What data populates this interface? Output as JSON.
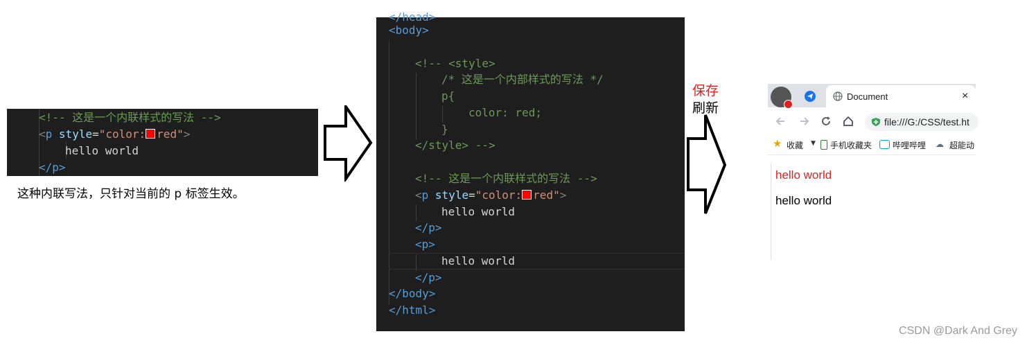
{
  "left_code": {
    "lines": [
      {
        "comment": "<!-- 这是一个内联样式的写法 -->"
      },
      {
        "p_open": "<p",
        "attr": "style",
        "eq": "=",
        "q1": "\"",
        "val1": "color:",
        "val2": "red",
        "q2": "\"",
        "close": ">"
      },
      {
        "text": "hello world"
      },
      {
        "p_close": "</p>"
      }
    ]
  },
  "left_caption": "这种内联写法，只针对当前的 p 标签生效。",
  "middle_code": {
    "head_close": "</head>",
    "body_open": "<body>",
    "style_comment_open": "<!-- <style>",
    "css_comment": "/* 这是一个内部样式的写法 */",
    "selector": "p{",
    "declaration": "color: red;",
    "brace_close": "}",
    "style_comment_close": "</style> -->",
    "inline_comment": "<!-- 这是一个内联样式的写法 -->",
    "p_open": "<p",
    "attr": "style",
    "eq": "=",
    "q1": "\"",
    "val1": "color:",
    "val2": "red",
    "q2": "\"",
    "gt": ">",
    "hello1": "hello world",
    "p_close1": "</p>",
    "p_open2": "<p>",
    "hello2": "hello world",
    "p_close2": "</p>",
    "body_close": "</body>",
    "html_close": "</html>"
  },
  "save_label": "保存",
  "refresh_label": "刷新",
  "browser": {
    "tab_title": "Document",
    "close_glyph": "×",
    "address": "file:///G:/CSS/test.ht",
    "bookmarks": [
      {
        "label": "收藏",
        "icon": "star-icon"
      },
      {
        "label": "手机收藏夹",
        "icon": "phone-icon"
      },
      {
        "label": "哔哩哔哩",
        "icon": "bilibili-icon"
      },
      {
        "label": "超能动",
        "icon": "cloud-icon"
      }
    ],
    "content": [
      {
        "text": "hello world",
        "color": "#e02020"
      },
      {
        "text": "hello world",
        "color": "#000000"
      }
    ]
  },
  "watermark": "CSDN @Dark And Grey",
  "colors": {
    "editor_bg": "#1e1e1e",
    "red_swatch": "#ff0000",
    "save_label": "#e02020"
  }
}
